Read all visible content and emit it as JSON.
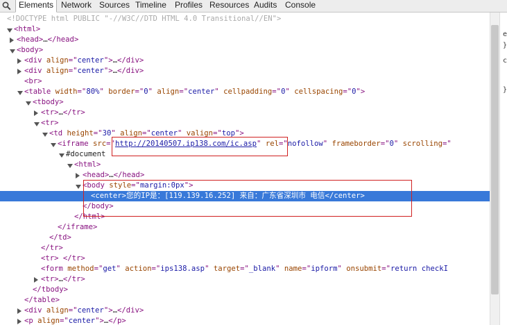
{
  "tabs": [
    "Elements",
    "Network",
    "Sources",
    "Timeline",
    "Profiles",
    "Resources",
    "Audits",
    "Console"
  ],
  "sidebar_glyphs": [
    "e",
    "}",
    "c",
    "}"
  ],
  "lines": [
    {
      "arrow": "",
      "segs": [
        [
          "dt",
          "<!DOCTYPE html PUBLIC \"-//W3C//DTD HTML 4.0 Transitional//EN\">"
        ]
      ]
    },
    {
      "arrow": "down",
      "segs": [
        [
          "tg",
          "<html>"
        ]
      ]
    },
    {
      "arrow": "right",
      "segs": [
        [
          "tg",
          "<head>"
        ],
        [
          "tx",
          "…"
        ],
        [
          "tg",
          "</head>"
        ]
      ]
    },
    {
      "arrow": "down",
      "segs": [
        [
          "tg",
          "<body>"
        ]
      ]
    },
    {
      "arrow": "right",
      "segs": [
        [
          "tg",
          "<div "
        ],
        [
          "at",
          "align"
        ],
        [
          "tg",
          "=\""
        ],
        [
          "av",
          "center"
        ],
        [
          "tg",
          "\">"
        ],
        [
          "tx",
          "…"
        ],
        [
          "tg",
          "</div>"
        ]
      ]
    },
    {
      "arrow": "right",
      "segs": [
        [
          "tg",
          "<div "
        ],
        [
          "at",
          "align"
        ],
        [
          "tg",
          "=\""
        ],
        [
          "av",
          "center"
        ],
        [
          "tg",
          "\">"
        ],
        [
          "tx",
          "…"
        ],
        [
          "tg",
          "</div>"
        ]
      ]
    },
    {
      "arrow": "",
      "segs": [
        [
          "tg",
          "<br>"
        ]
      ]
    },
    {
      "arrow": "down",
      "segs": [
        [
          "tg",
          "<table "
        ],
        [
          "at",
          "width"
        ],
        [
          "tg",
          "=\""
        ],
        [
          "av",
          "80%"
        ],
        [
          "tg",
          "\" "
        ],
        [
          "at",
          "border"
        ],
        [
          "tg",
          "=\""
        ],
        [
          "av",
          "0"
        ],
        [
          "tg",
          "\" "
        ],
        [
          "at",
          "align"
        ],
        [
          "tg",
          "=\""
        ],
        [
          "av",
          "center"
        ],
        [
          "tg",
          "\" "
        ],
        [
          "at",
          "cellpadding"
        ],
        [
          "tg",
          "=\""
        ],
        [
          "av",
          "0"
        ],
        [
          "tg",
          "\" "
        ],
        [
          "at",
          "cellspacing"
        ],
        [
          "tg",
          "=\""
        ],
        [
          "av",
          "0"
        ],
        [
          "tg",
          "\">"
        ]
      ]
    },
    {
      "arrow": "down",
      "segs": [
        [
          "tg",
          "<tbody>"
        ]
      ]
    },
    {
      "arrow": "right",
      "segs": [
        [
          "tg",
          "<tr>"
        ],
        [
          "tx",
          "…"
        ],
        [
          "tg",
          "</tr>"
        ]
      ]
    },
    {
      "arrow": "down",
      "segs": [
        [
          "tg",
          "<tr>"
        ]
      ]
    },
    {
      "arrow": "down",
      "segs": [
        [
          "tg",
          "<td "
        ],
        [
          "at",
          "height"
        ],
        [
          "tg",
          "=\""
        ],
        [
          "av",
          "30"
        ],
        [
          "tg",
          "\" "
        ],
        [
          "at",
          "align"
        ],
        [
          "tg",
          "=\""
        ],
        [
          "av",
          "center"
        ],
        [
          "tg",
          "\" "
        ],
        [
          "at",
          "valign"
        ],
        [
          "tg",
          "=\""
        ],
        [
          "av",
          "top"
        ],
        [
          "tg",
          "\">"
        ]
      ]
    },
    {
      "arrow": "down",
      "segs": [
        [
          "tg",
          "<iframe "
        ],
        [
          "at",
          "src"
        ],
        [
          "tg",
          "=\""
        ],
        [
          "lnk",
          "http://20140507.ip138.com/ic.asp"
        ],
        [
          "tg",
          "\" "
        ],
        [
          "at",
          "rel"
        ],
        [
          "tg",
          "=\""
        ],
        [
          "av",
          "nofollow"
        ],
        [
          "tg",
          "\" "
        ],
        [
          "at",
          "frameborder"
        ],
        [
          "tg",
          "=\""
        ],
        [
          "av",
          "0"
        ],
        [
          "tg",
          "\" "
        ],
        [
          "at",
          "scrolling"
        ],
        [
          "tg",
          "=\""
        ]
      ]
    },
    {
      "arrow": "down",
      "segs": [
        [
          "tx",
          "#document"
        ]
      ]
    },
    {
      "arrow": "down",
      "segs": [
        [
          "tg",
          "<html>"
        ]
      ]
    },
    {
      "arrow": "right",
      "segs": [
        [
          "tg",
          "<head>"
        ],
        [
          "tx",
          "…"
        ],
        [
          "tg",
          "</head>"
        ]
      ]
    },
    {
      "arrow": "down",
      "segs": [
        [
          "tg",
          "<body "
        ],
        [
          "at",
          "style"
        ],
        [
          "tg",
          "=\""
        ],
        [
          "av",
          "margin:0px"
        ],
        [
          "tg",
          "\">"
        ]
      ]
    },
    {
      "arrow": "",
      "sel": true,
      "segs": [
        [
          "tg",
          "<center>"
        ],
        [
          "tx",
          "您的IP是：[119.139.16.252] 来自：广东省深圳市 电信"
        ],
        [
          "tg",
          "</center>"
        ]
      ]
    },
    {
      "arrow": "",
      "segs": [
        [
          "tg",
          "</body>"
        ]
      ]
    },
    {
      "arrow": "",
      "segs": [
        [
          "tg",
          "</html>"
        ]
      ]
    },
    {
      "arrow": "",
      "segs": [
        [
          "tg",
          "</iframe>"
        ]
      ]
    },
    {
      "arrow": "",
      "segs": [
        [
          "tg",
          "</td>"
        ]
      ]
    },
    {
      "arrow": "",
      "segs": [
        [
          "tg",
          "</tr>"
        ]
      ]
    },
    {
      "arrow": "",
      "segs": [
        [
          "tg",
          "<tr> </tr>"
        ]
      ]
    },
    {
      "arrow": "",
      "segs": [
        [
          "tg",
          "<form "
        ],
        [
          "at",
          "method"
        ],
        [
          "tg",
          "=\""
        ],
        [
          "av",
          "get"
        ],
        [
          "tg",
          "\" "
        ],
        [
          "at",
          "action"
        ],
        [
          "tg",
          "=\""
        ],
        [
          "av",
          "ips138.asp"
        ],
        [
          "tg",
          "\" "
        ],
        [
          "at",
          "target"
        ],
        [
          "tg",
          "=\""
        ],
        [
          "av",
          "_blank"
        ],
        [
          "tg",
          "\" "
        ],
        [
          "at",
          "name"
        ],
        [
          "tg",
          "=\""
        ],
        [
          "av",
          "ipform"
        ],
        [
          "tg",
          "\" "
        ],
        [
          "at",
          "onsubmit"
        ],
        [
          "tg",
          "=\""
        ],
        [
          "av",
          "return checkI"
        ]
      ]
    },
    {
      "arrow": "right",
      "segs": [
        [
          "tg",
          "<tr>"
        ],
        [
          "tx",
          "…"
        ],
        [
          "tg",
          "</tr>"
        ]
      ]
    },
    {
      "arrow": "",
      "segs": [
        [
          "tg",
          "</tbody>"
        ]
      ]
    },
    {
      "arrow": "",
      "segs": [
        [
          "tg",
          "</table>"
        ]
      ]
    },
    {
      "arrow": "right",
      "segs": [
        [
          "tg",
          "<div "
        ],
        [
          "at",
          "align"
        ],
        [
          "tg",
          "=\""
        ],
        [
          "av",
          "center"
        ],
        [
          "tg",
          "\">"
        ],
        [
          "tx",
          "…"
        ],
        [
          "tg",
          "</div>"
        ]
      ]
    },
    {
      "arrow": "right",
      "segs": [
        [
          "tg",
          "<p "
        ],
        [
          "at",
          "align"
        ],
        [
          "tg",
          "=\""
        ],
        [
          "av",
          "center"
        ],
        [
          "tg",
          "\">"
        ],
        [
          "tx",
          "…"
        ],
        [
          "tg",
          "</p>"
        ]
      ]
    }
  ]
}
